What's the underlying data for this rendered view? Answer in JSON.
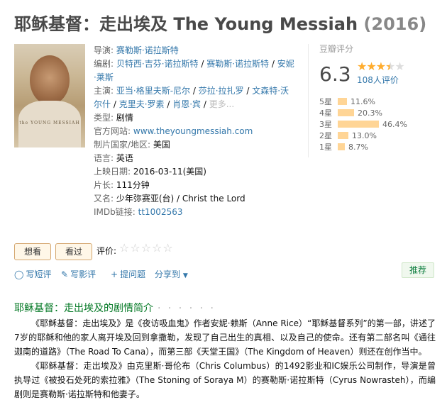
{
  "title": {
    "main": "耶稣基督：走出埃及 The Young Messiah",
    "year": "(2016)"
  },
  "poster": {
    "text": "the YOUNG MESSIAH"
  },
  "info": {
    "director_label": "导演:",
    "director": "赛勒斯·诺拉斯特",
    "writer_label": "编剧:",
    "writer_1": "贝特西·吉芬·诺拉斯特",
    "writer_2": "赛勒斯·诺拉斯特",
    "writer_3": "安妮·莱斯",
    "cast_label": "主演:",
    "cast_1": "亚当·格里夫斯-尼尔",
    "cast_2": "莎拉·拉扎罗",
    "cast_3": "文森特·沃尔什",
    "cast_4": "克里夫·罗素",
    "cast_5": "肖恩·宾",
    "cast_more": "更多...",
    "slash": " / ",
    "genre_label": "类型:",
    "genre": "剧情",
    "site_label": "官方网站:",
    "site": "www.theyoungmessiah.com",
    "country_label": "制片国家/地区:",
    "country": "美国",
    "lang_label": "语言:",
    "lang": "英语",
    "release_label": "上映日期:",
    "release": "2016-03-11(美国)",
    "runtime_label": "片长:",
    "runtime": "111分钟",
    "aka_label": "又名:",
    "aka": "少年弥赛亚(台) / Christ the Lord",
    "imdb_label": "IMDb链接:",
    "imdb": "tt1002563"
  },
  "rating": {
    "header": "豆瓣评分",
    "score": "6.3",
    "stars_value": 3.5,
    "people": "108人评价",
    "distribution": [
      {
        "label": "5星",
        "pct": "11.6%",
        "value": 11.6
      },
      {
        "label": "4星",
        "pct": "20.3%",
        "value": 20.3
      },
      {
        "label": "3星",
        "pct": "46.4%",
        "value": 46.4
      },
      {
        "label": "2星",
        "pct": "13.0%",
        "value": 13.0
      },
      {
        "label": "1星",
        "pct": "8.7%",
        "value": 8.7
      }
    ]
  },
  "actions": {
    "want": "想看",
    "seen": "看过",
    "rate_label": "评价:",
    "rate_stars": "☆☆☆☆☆"
  },
  "tools": {
    "review": "写短评",
    "long_review": "写影评",
    "question": "提问题",
    "share": "分享到",
    "share_arrow": "▼",
    "recommend": "推荐"
  },
  "icons": {
    "review": "comment-icon",
    "long_review": "pencil-icon",
    "question": "plus-icon"
  },
  "colors": {
    "link": "#3377aa",
    "section_title": "#007722",
    "star": "#ffac2d",
    "bar": "#ffd596",
    "button_border": "#d4a66e",
    "button_bg": "#fff7e8"
  },
  "summary": {
    "title": "耶稣基督：走出埃及的剧情简介",
    "dots": "· · · · · ·",
    "p1": "《耶稣基督：走出埃及》是《夜访吸血鬼》作者安妮·赖斯（Anne Rice）“耶稣基督系列”的第一部，讲述了7岁的耶稣和他的家人离开埃及回到拿撒勒，发现了自己出生的真相、以及自己的使命。还有第二部名叫《通往迦南的道路》（The Road To Cana），而第三部《天堂王国》（The Kingdom of Heaven）则还在创作当中。",
    "p2": "《耶稣基督：走出埃及》由克里斯·哥伦布（Chris Columbus）的1492影业和IC娱乐公司制作，导演是曾执导过《被投石处死的索拉雅》（The Stoning of Soraya M）的赛勒斯·诺拉斯特（Cyrus Nowrasteh），而编剧则是赛勒斯·诺拉斯特和他妻子。"
  }
}
